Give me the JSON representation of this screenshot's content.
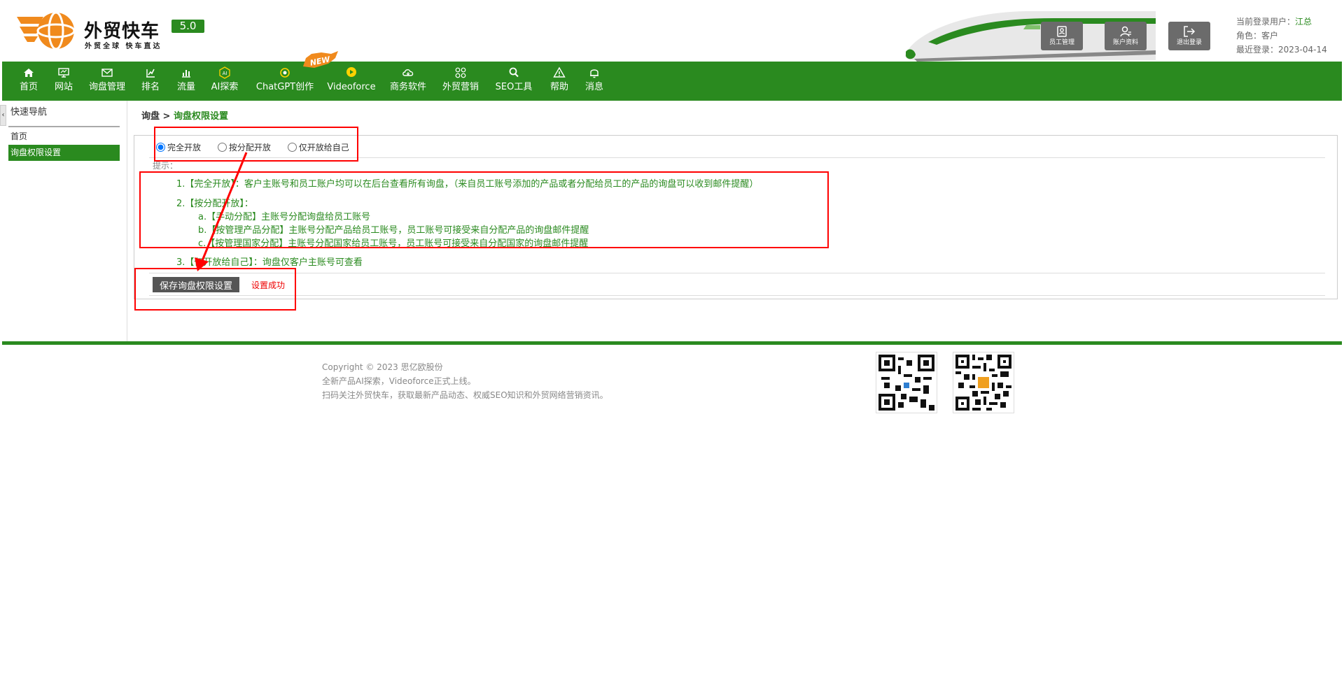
{
  "brand": {
    "title": "外贸快车",
    "subtitle": "外贸全球 快车直达",
    "version": "5.0"
  },
  "header_buttons": [
    {
      "label": "员工管理",
      "icon": "staff-icon"
    },
    {
      "label": "账户资料",
      "icon": "user-profile-icon"
    },
    {
      "label": "退出登录",
      "icon": "logout-icon"
    }
  ],
  "user_info": {
    "user_label": "当前登录用户：",
    "user_value": "江总",
    "role_label": "角色：",
    "role_value": "客户",
    "last_login_label": "最近登录：",
    "last_login_value": "2023-04-14"
  },
  "nav": {
    "items": [
      {
        "label": "首页",
        "icon": "home-icon"
      },
      {
        "label": "网站",
        "icon": "monitor-icon"
      },
      {
        "label": "询盘管理",
        "icon": "mail-icon"
      },
      {
        "label": "排名",
        "icon": "ranking-icon"
      },
      {
        "label": "流量",
        "icon": "bar-chart-icon"
      },
      {
        "label": "AI探索",
        "icon": "ai-icon"
      },
      {
        "label": "ChatGPT创作",
        "icon": "chatgpt-icon"
      },
      {
        "label": "Videoforce",
        "icon": "video-icon"
      },
      {
        "label": "商务软件",
        "icon": "cloud-icon"
      },
      {
        "label": "外贸营销",
        "icon": "grid-icon"
      },
      {
        "label": "SEO工具",
        "icon": "search-icon"
      },
      {
        "label": "帮助",
        "icon": "warning-icon"
      },
      {
        "label": "消息",
        "icon": "bell-icon"
      }
    ],
    "new_badge": "NEW"
  },
  "sidebar": {
    "title": "快速导航",
    "items": [
      {
        "label": "首页"
      },
      {
        "label": "询盘权限设置"
      }
    ]
  },
  "breadcrumb": {
    "parent": "询盘",
    "separator": " > ",
    "current": "询盘权限设置"
  },
  "permissions": {
    "options": [
      {
        "label": "完全开放",
        "selected": true
      },
      {
        "label": "按分配开放",
        "selected": false
      },
      {
        "label": "仅开放给自己",
        "selected": false
      }
    ],
    "tips_label": "提示：",
    "tips": [
      "1.【完全开放】：客户主账号和员工账户均可以在后台查看所有询盘，（来自员工账号添加的产品或者分配给员工的产品的询盘可以收到邮件提醒）",
      "2.【按分配开放】：",
      "a.【手动分配】主账号分配询盘给员工账号",
      "b.【按管理产品分配】主账号分配产品给员工账号，员工账号可接受来自分配产品的询盘邮件提醒",
      "c.【按管理国家分配】主账号分配国家给员工账号，员工账号可接受来自分配国家的询盘邮件提醒",
      "3.【仅开放给自己】：询盘仅客户主账号可查看"
    ],
    "save_label": "保存询盘权限设置",
    "save_message": "设置成功"
  },
  "footer": {
    "lines": [
      "Copyright © 2023 思亿欧股份",
      "全新产品AI探索，Videoforce正式上线。",
      "扫码关注外贸快车，获取最新产品动态、权威SEO知识和外贸网络营销资讯。"
    ]
  },
  "colors": {
    "brand_green": "#2a8a1f",
    "logo_orange": "#f08a1d",
    "annotation_red": "#ff0000"
  }
}
